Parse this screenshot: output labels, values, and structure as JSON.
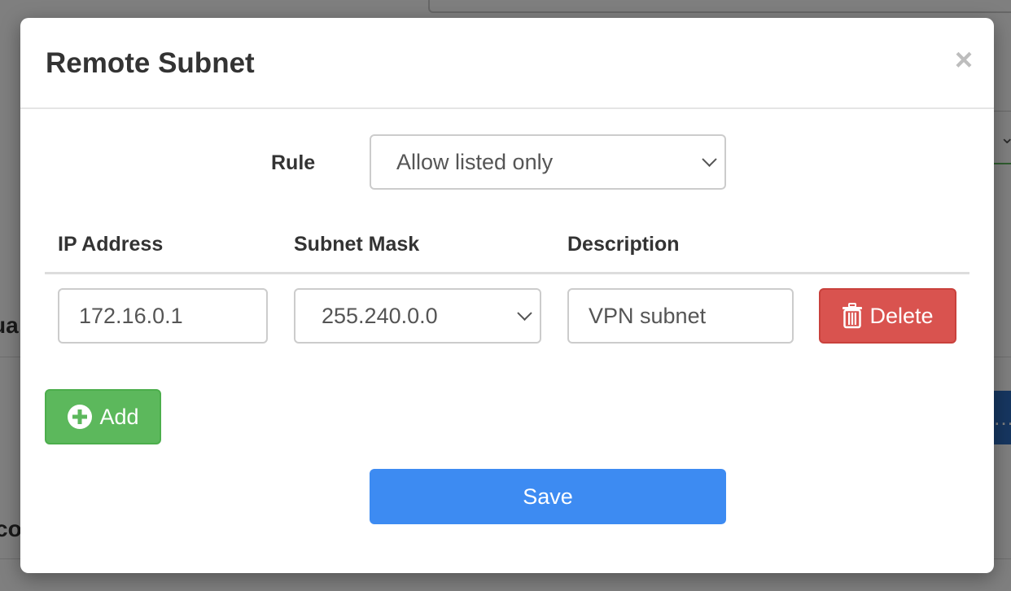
{
  "modal": {
    "title": "Remote Subnet",
    "close_glyph": "×"
  },
  "rule": {
    "label": "Rule",
    "selected": "Allow listed only"
  },
  "table": {
    "headers": [
      "IP Address",
      "Subnet Mask",
      "Description"
    ],
    "rows": [
      {
        "ip_address": "172.16.0.1",
        "subnet_mask": "255.240.0.0",
        "description": "VPN subnet",
        "delete_label": "Delete"
      }
    ]
  },
  "buttons": {
    "add_label": "Add",
    "save_label": "Save"
  },
  "icons": {
    "delete": "trash-icon",
    "add": "plus-circle-icon",
    "close": "close-icon",
    "dropdown": "chevron-down-icon"
  },
  "colors": {
    "delete": "#d9534f",
    "add": "#5cb85c",
    "save": "#3d8bf2"
  }
}
